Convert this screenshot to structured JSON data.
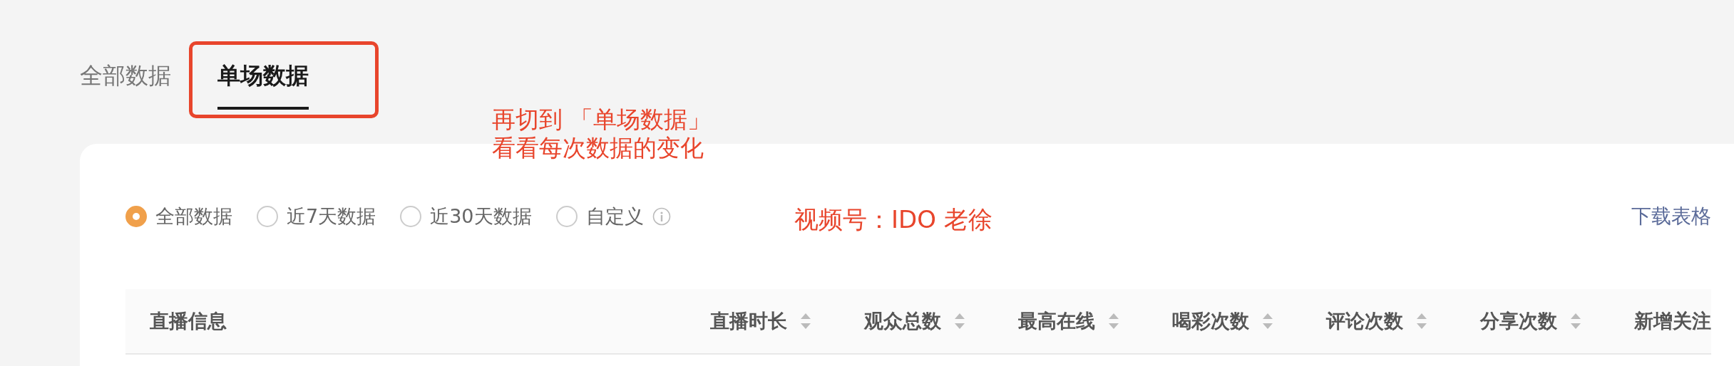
{
  "tabs": [
    {
      "label": "全部数据",
      "selected": false,
      "highlighted": false
    },
    {
      "label": "单场数据",
      "selected": true,
      "highlighted": true
    }
  ],
  "annotation": {
    "lines": [
      "再切到 「单场数据」",
      "看看每次数据的变化"
    ],
    "credit": "视频号：IDO 老徐"
  },
  "filters": [
    {
      "label": "全部数据",
      "selected": true,
      "kind": "plain"
    },
    {
      "label": "近7天数据",
      "selected": false,
      "kind": "plain"
    },
    {
      "label": "近30天数据",
      "selected": false,
      "kind": "plain"
    },
    {
      "label": "自定义",
      "selected": false,
      "kind": "info"
    }
  ],
  "download_link": "下载表格",
  "table": {
    "columns": [
      {
        "label": "直播信息",
        "kind": "plain"
      },
      {
        "label": "直播时长",
        "kind": "sortable"
      },
      {
        "label": "观众总数",
        "kind": "sortable"
      },
      {
        "label": "最高在线",
        "kind": "sortable"
      },
      {
        "label": "喝彩次数",
        "kind": "sortable"
      },
      {
        "label": "评论次数",
        "kind": "sortable"
      },
      {
        "label": "分享次数",
        "kind": "sortable"
      },
      {
        "label": "新增关注",
        "kind": "plain"
      }
    ]
  }
}
